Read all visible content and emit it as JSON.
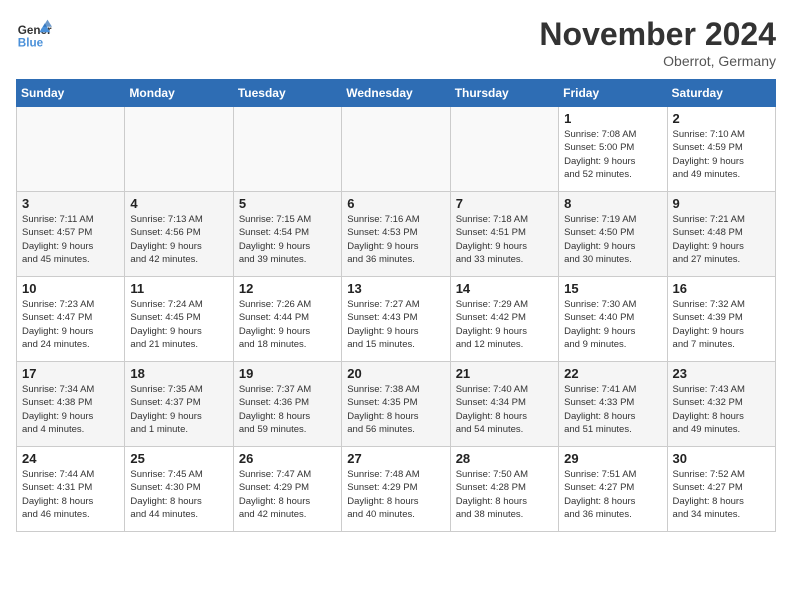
{
  "logo": {
    "text1": "General",
    "text2": "Blue"
  },
  "title": "November 2024",
  "location": "Oberrot, Germany",
  "days_of_week": [
    "Sunday",
    "Monday",
    "Tuesday",
    "Wednesday",
    "Thursday",
    "Friday",
    "Saturday"
  ],
  "weeks": [
    [
      {
        "day": "",
        "info": ""
      },
      {
        "day": "",
        "info": ""
      },
      {
        "day": "",
        "info": ""
      },
      {
        "day": "",
        "info": ""
      },
      {
        "day": "",
        "info": ""
      },
      {
        "day": "1",
        "info": "Sunrise: 7:08 AM\nSunset: 5:00 PM\nDaylight: 9 hours\nand 52 minutes."
      },
      {
        "day": "2",
        "info": "Sunrise: 7:10 AM\nSunset: 4:59 PM\nDaylight: 9 hours\nand 49 minutes."
      }
    ],
    [
      {
        "day": "3",
        "info": "Sunrise: 7:11 AM\nSunset: 4:57 PM\nDaylight: 9 hours\nand 45 minutes."
      },
      {
        "day": "4",
        "info": "Sunrise: 7:13 AM\nSunset: 4:56 PM\nDaylight: 9 hours\nand 42 minutes."
      },
      {
        "day": "5",
        "info": "Sunrise: 7:15 AM\nSunset: 4:54 PM\nDaylight: 9 hours\nand 39 minutes."
      },
      {
        "day": "6",
        "info": "Sunrise: 7:16 AM\nSunset: 4:53 PM\nDaylight: 9 hours\nand 36 minutes."
      },
      {
        "day": "7",
        "info": "Sunrise: 7:18 AM\nSunset: 4:51 PM\nDaylight: 9 hours\nand 33 minutes."
      },
      {
        "day": "8",
        "info": "Sunrise: 7:19 AM\nSunset: 4:50 PM\nDaylight: 9 hours\nand 30 minutes."
      },
      {
        "day": "9",
        "info": "Sunrise: 7:21 AM\nSunset: 4:48 PM\nDaylight: 9 hours\nand 27 minutes."
      }
    ],
    [
      {
        "day": "10",
        "info": "Sunrise: 7:23 AM\nSunset: 4:47 PM\nDaylight: 9 hours\nand 24 minutes."
      },
      {
        "day": "11",
        "info": "Sunrise: 7:24 AM\nSunset: 4:45 PM\nDaylight: 9 hours\nand 21 minutes."
      },
      {
        "day": "12",
        "info": "Sunrise: 7:26 AM\nSunset: 4:44 PM\nDaylight: 9 hours\nand 18 minutes."
      },
      {
        "day": "13",
        "info": "Sunrise: 7:27 AM\nSunset: 4:43 PM\nDaylight: 9 hours\nand 15 minutes."
      },
      {
        "day": "14",
        "info": "Sunrise: 7:29 AM\nSunset: 4:42 PM\nDaylight: 9 hours\nand 12 minutes."
      },
      {
        "day": "15",
        "info": "Sunrise: 7:30 AM\nSunset: 4:40 PM\nDaylight: 9 hours\nand 9 minutes."
      },
      {
        "day": "16",
        "info": "Sunrise: 7:32 AM\nSunset: 4:39 PM\nDaylight: 9 hours\nand 7 minutes."
      }
    ],
    [
      {
        "day": "17",
        "info": "Sunrise: 7:34 AM\nSunset: 4:38 PM\nDaylight: 9 hours\nand 4 minutes."
      },
      {
        "day": "18",
        "info": "Sunrise: 7:35 AM\nSunset: 4:37 PM\nDaylight: 9 hours\nand 1 minute."
      },
      {
        "day": "19",
        "info": "Sunrise: 7:37 AM\nSunset: 4:36 PM\nDaylight: 8 hours\nand 59 minutes."
      },
      {
        "day": "20",
        "info": "Sunrise: 7:38 AM\nSunset: 4:35 PM\nDaylight: 8 hours\nand 56 minutes."
      },
      {
        "day": "21",
        "info": "Sunrise: 7:40 AM\nSunset: 4:34 PM\nDaylight: 8 hours\nand 54 minutes."
      },
      {
        "day": "22",
        "info": "Sunrise: 7:41 AM\nSunset: 4:33 PM\nDaylight: 8 hours\nand 51 minutes."
      },
      {
        "day": "23",
        "info": "Sunrise: 7:43 AM\nSunset: 4:32 PM\nDaylight: 8 hours\nand 49 minutes."
      }
    ],
    [
      {
        "day": "24",
        "info": "Sunrise: 7:44 AM\nSunset: 4:31 PM\nDaylight: 8 hours\nand 46 minutes."
      },
      {
        "day": "25",
        "info": "Sunrise: 7:45 AM\nSunset: 4:30 PM\nDaylight: 8 hours\nand 44 minutes."
      },
      {
        "day": "26",
        "info": "Sunrise: 7:47 AM\nSunset: 4:29 PM\nDaylight: 8 hours\nand 42 minutes."
      },
      {
        "day": "27",
        "info": "Sunrise: 7:48 AM\nSunset: 4:29 PM\nDaylight: 8 hours\nand 40 minutes."
      },
      {
        "day": "28",
        "info": "Sunrise: 7:50 AM\nSunset: 4:28 PM\nDaylight: 8 hours\nand 38 minutes."
      },
      {
        "day": "29",
        "info": "Sunrise: 7:51 AM\nSunset: 4:27 PM\nDaylight: 8 hours\nand 36 minutes."
      },
      {
        "day": "30",
        "info": "Sunrise: 7:52 AM\nSunset: 4:27 PM\nDaylight: 8 hours\nand 34 minutes."
      }
    ]
  ]
}
